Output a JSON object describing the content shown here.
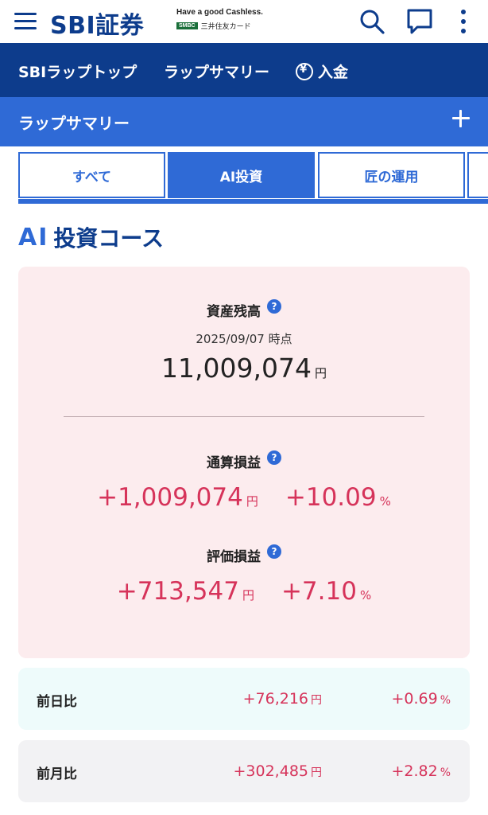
{
  "header": {
    "logo": "SBI証券",
    "tagline": "Have a good Cashless.",
    "card_issuer": "SMBC",
    "card_name": "三井住友カード"
  },
  "topnav": {
    "items": [
      {
        "label": "SBIラップトップ"
      },
      {
        "label": "ラップサマリー"
      },
      {
        "label": "入金"
      }
    ]
  },
  "summary_bar": {
    "title": "ラップサマリー"
  },
  "tabs": [
    {
      "label": "すべて"
    },
    {
      "label": "AI投資"
    },
    {
      "label": "匠の運用"
    }
  ],
  "course": {
    "mark": "AI",
    "name": "投資コース"
  },
  "balance": {
    "label": "資産残高",
    "date": "2025/09/07 時点",
    "amount": "11,009,074",
    "unit": "円"
  },
  "cumulative_pl": {
    "label": "通算損益",
    "amount": "+1,009,074",
    "unit": "円",
    "percent": "+10.09",
    "percent_unit": "%"
  },
  "valuation_pl": {
    "label": "評価損益",
    "amount": "+713,547",
    "unit": "円",
    "percent": "+7.10",
    "percent_unit": "%"
  },
  "day_diff": {
    "label": "前日比",
    "amount": "+76,216",
    "unit": "円",
    "percent": "+0.69",
    "percent_unit": "%"
  },
  "month_diff": {
    "label": "前月比",
    "amount": "+302,485",
    "unit": "円",
    "percent": "+2.82",
    "percent_unit": "%"
  },
  "help_glyph": "?",
  "colors": {
    "navy": "#0d3c8c",
    "blue": "#2f6ad6",
    "gain_red": "#d6335a",
    "card_pink": "#fcecee"
  }
}
